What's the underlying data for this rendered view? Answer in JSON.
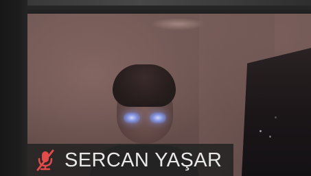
{
  "participant": {
    "name": "SERCAN YAŞAR",
    "mic_icon": "microphone-muted-icon",
    "mic_state": "muted"
  },
  "colors": {
    "mic_muted": "#e34b4b",
    "name_text": "#e9e9e9",
    "name_tag_bg": "#222222",
    "background": "#1f1f1f"
  }
}
